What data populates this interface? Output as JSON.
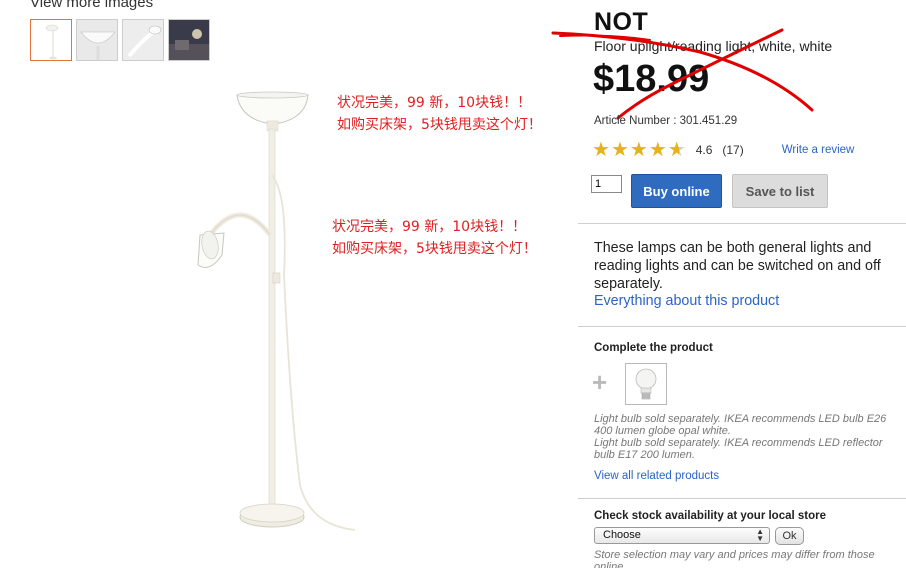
{
  "gallery": {
    "view_more_label": "View more images",
    "thumbnails": [
      "floor-lamp-full",
      "lamp-shade-closeup",
      "reading-arm-closeup",
      "room-scene"
    ]
  },
  "notes": {
    "note1_line1": "状况完美，99 新，10块钱！！",
    "note1_line2": "如购买床架，5块钱甩卖这个灯！",
    "note2_line1": "状况完美，99 新，10块钱！！",
    "note2_line2": "如购买床架，5块钱甩卖这个灯！",
    "color": "#e02020"
  },
  "product": {
    "name": "NOT",
    "description": "Floor uplight/reading light, white, white",
    "price": "$18.99",
    "article_number": "Article Number : 301.451.29",
    "rating_value": "4.6",
    "rating_count": "(17)",
    "rating_stars": 4.6,
    "write_review": "Write a review",
    "quantity": "1",
    "buy_label": "Buy online",
    "save_label": "Save to list",
    "summary": "These lamps can be both general lights and reading lights and can be switched on and off separately.",
    "summary_link": "Everything about this product",
    "strike_color": "#e00000"
  },
  "complete": {
    "title": "Complete the product",
    "plus": "+",
    "note_line1": "Light bulb sold separately. IKEA recommends LED bulb E26 400 lumen globe opal white.",
    "note_line2": "Light bulb sold separately. IKEA recommends LED reflector bulb E17 200 lumen.",
    "related_link": "View all related products"
  },
  "stock": {
    "title": "Check stock availability at your local store",
    "select_value": "Choose",
    "ok_label": "Ok",
    "note": "Store selection may vary and prices may differ from those online."
  },
  "colors": {
    "link": "#2c63c7",
    "buy_button": "#2f6cc0",
    "star": "#e6b21a"
  }
}
